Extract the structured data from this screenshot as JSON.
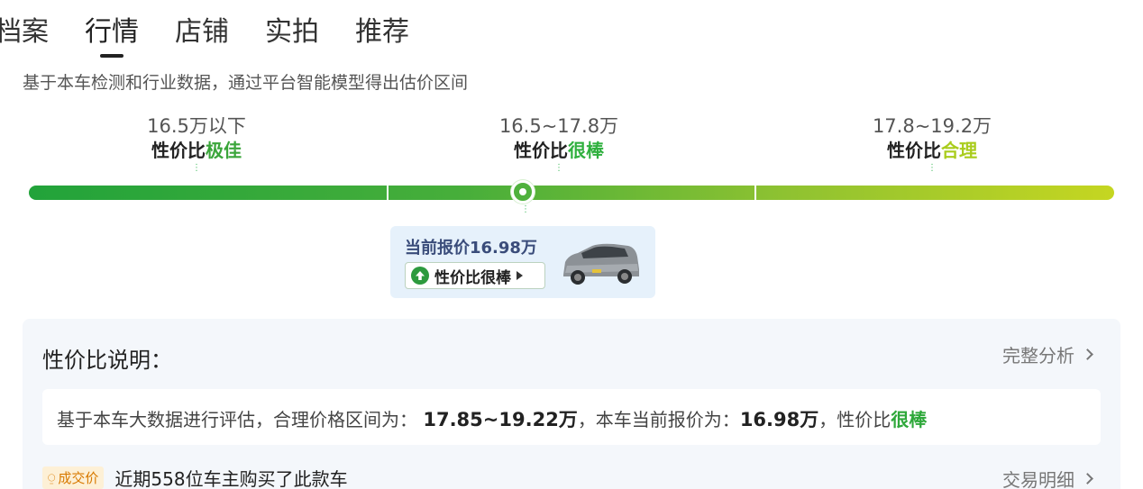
{
  "tabs": [
    {
      "label": "档案",
      "active": false
    },
    {
      "label": "行情",
      "active": true
    },
    {
      "label": "店铺",
      "active": false
    },
    {
      "label": "实拍",
      "active": false
    },
    {
      "label": "推荐",
      "active": false
    }
  ],
  "subtitle": "基于本车检测和行业数据，通过平台智能模型得出估价区间",
  "ranges": [
    {
      "price": "16.5万以下",
      "grade_prefix": "性价比",
      "grade_hl": "极佳",
      "hl_color": "#3aa53a"
    },
    {
      "price": "16.5~17.8万",
      "grade_prefix": "性价比",
      "grade_hl": "很棒",
      "hl_color": "#2fb03e"
    },
    {
      "price": "17.8~19.2万",
      "grade_prefix": "性价比",
      "grade_hl": "合理",
      "hl_color": "#a9cc1c"
    }
  ],
  "current_price": {
    "label": "当前报价16.98万",
    "badge": "性价比很棒",
    "marker_fraction": 0.455
  },
  "panel": {
    "title": "性价比说明：",
    "full_analysis_link": "完整分析",
    "desc_prefix": "基于本车大数据进行评估，合理价格区间为：",
    "desc_range": "17.85~19.22万",
    "desc_middle": "，本车当前报价为：",
    "desc_price": "16.98万",
    "desc_suffix": "，性价比",
    "desc_grade": "很棒",
    "deal_tag": "成交价",
    "deal_text": "近期558位车主购买了此款车",
    "trade_link": "交易明细"
  },
  "colors": {
    "accent_green": "#2ea83a",
    "deal_orange": "#d87a00",
    "card_bg": "#e6f1fb"
  }
}
